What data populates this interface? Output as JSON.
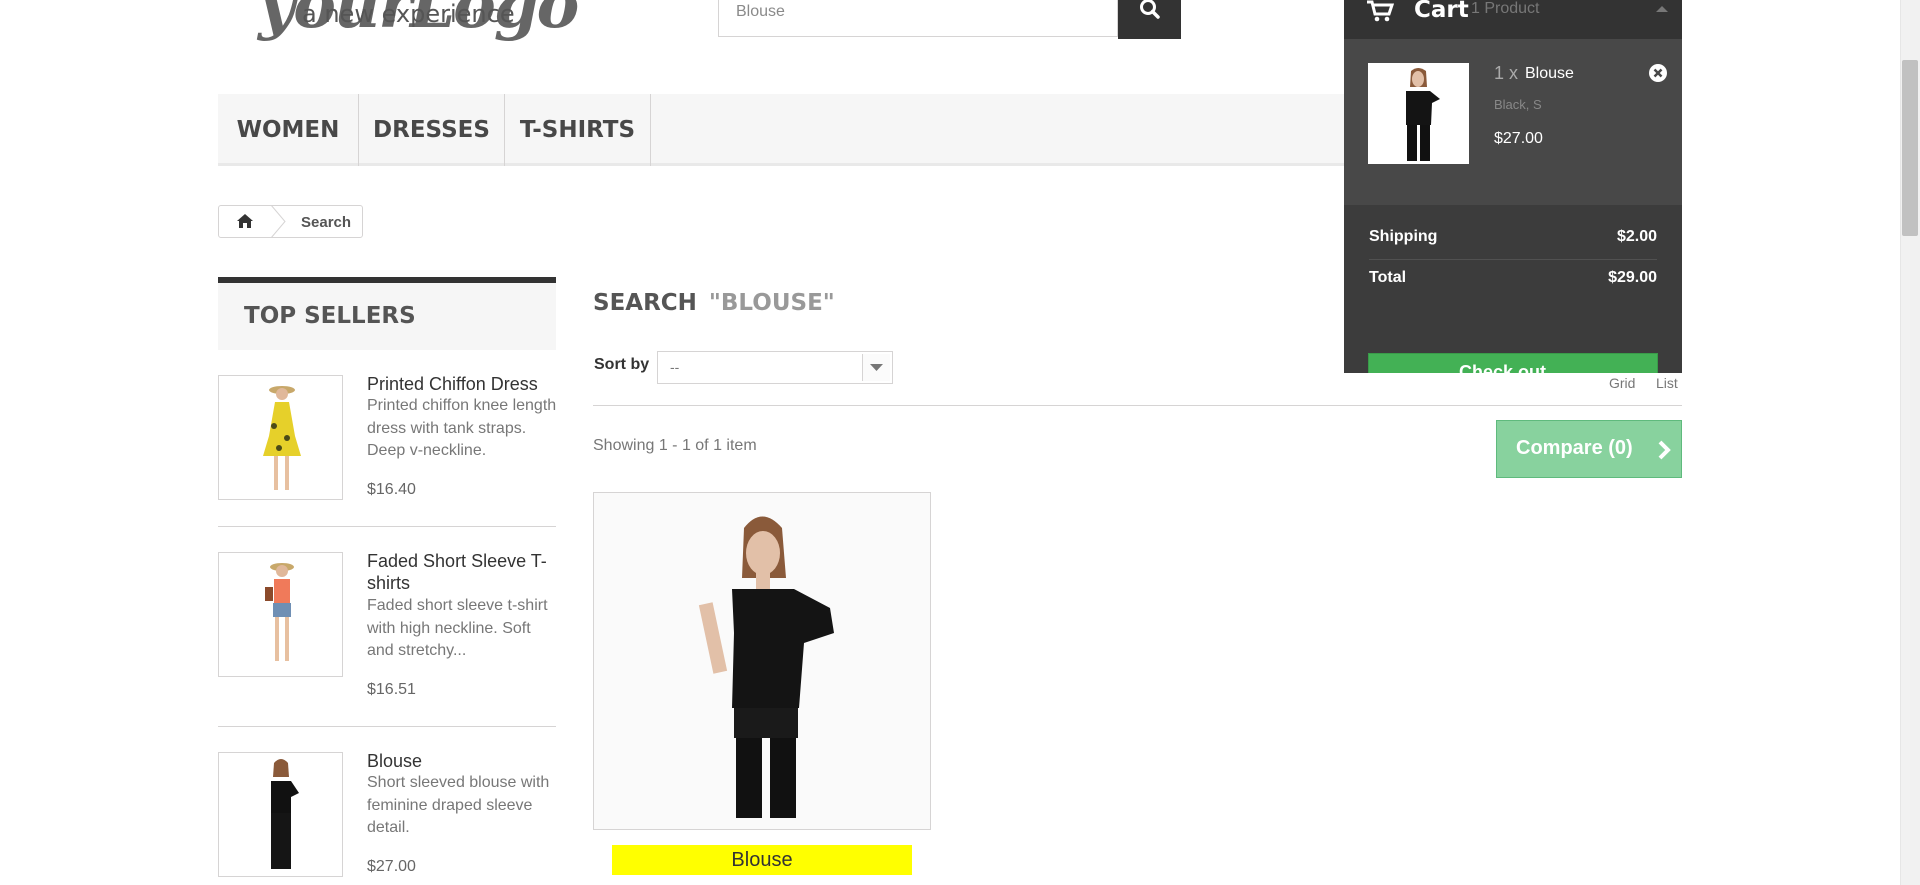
{
  "logo": {
    "script_text": "yourLogo",
    "tagline": "a new experience"
  },
  "search": {
    "value": "Blouse"
  },
  "menu": {
    "items": [
      "WOMEN",
      "DRESSES",
      "T-SHIRTS"
    ]
  },
  "breadcrumb": {
    "current": "Search"
  },
  "top_sellers": {
    "title": "TOP SELLERS",
    "items": [
      {
        "name": "Printed Chiffon Dress",
        "description": "Printed chiffon knee length dress with tank straps. Deep v-neckline.",
        "price": "$16.40"
      },
      {
        "name": "Faded Short Sleeve T-shirts",
        "description": "Faded short sleeve t-shirt with high neckline. Soft and stretchy...",
        "price": "$16.51"
      },
      {
        "name": "Blouse",
        "description": "Short sleeved blouse with feminine draped sleeve detail.",
        "price": "$27.00"
      }
    ]
  },
  "main": {
    "heading": "SEARCH",
    "query": "\"BLOUSE\"",
    "sort_label": "Sort by",
    "sort_value": "--",
    "view_grid": "Grid",
    "view_list": "List",
    "showing": "Showing 1 - 1 of 1 item",
    "compare_label": "Compare (0)",
    "products": [
      {
        "name": "Blouse"
      }
    ]
  },
  "cart": {
    "label": "Cart",
    "count": "1 Product",
    "item": {
      "qty": "1 x",
      "name": "Blouse",
      "attributes": "Black, S",
      "price": "$27.00"
    },
    "shipping_label": "Shipping",
    "shipping_value": "$2.00",
    "total_label": "Total",
    "total_value": "$29.00",
    "checkout_label": "Check out"
  },
  "colors": {
    "accent_green": "#43b155",
    "compare_green": "#88d29e",
    "highlight": "#ffff00",
    "dark": "#333333"
  }
}
